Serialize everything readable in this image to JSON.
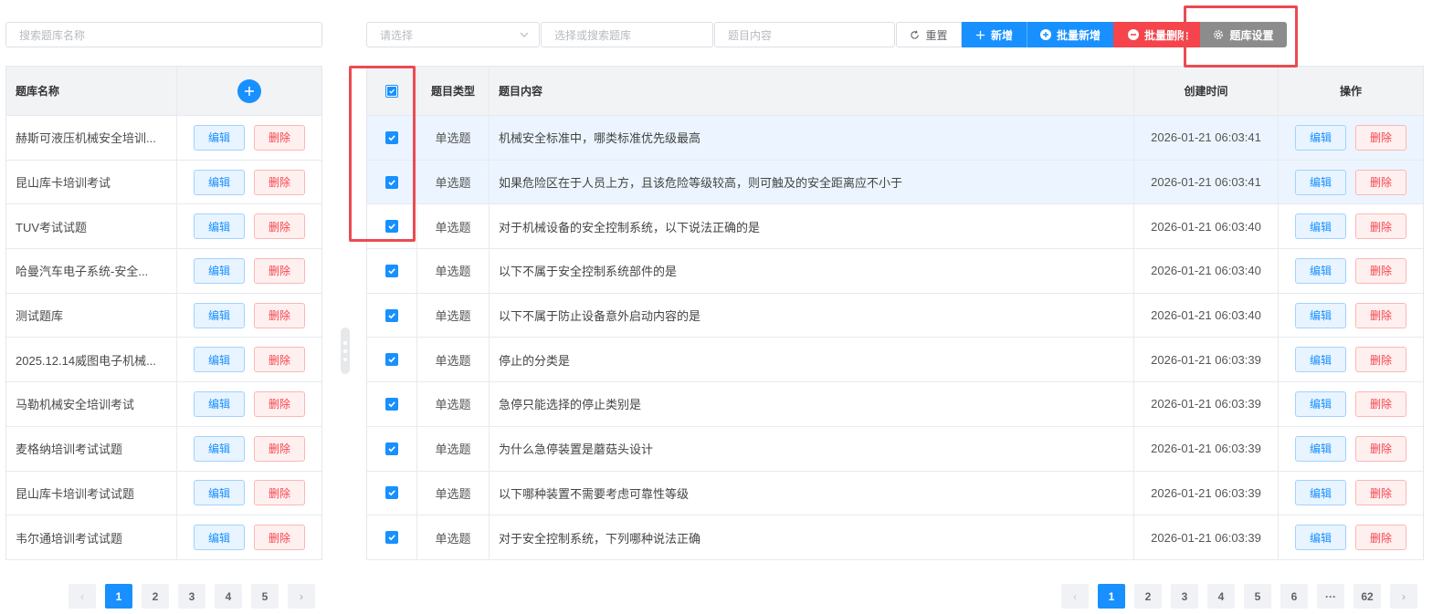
{
  "search_library_placeholder": "搜索题库名称",
  "filters": {
    "select_placeholder": "请选择",
    "library_placeholder": "选择或搜索题库",
    "content_placeholder": "题目内容"
  },
  "toolbar": {
    "reset": "重置",
    "add": "新增",
    "batch_add": "批量新增",
    "batch_delete": "批量删除",
    "library_settings": "题库设置"
  },
  "left_table": {
    "header_name": "题库名称",
    "edit_label": "编辑",
    "delete_label": "删除",
    "rows": [
      "赫斯可液压机械安全培训...",
      "昆山库卡培训考试",
      "TUV考试试题",
      "哈曼汽车电子系统-安全...",
      "测试题库",
      "2025.12.14威图电子机械...",
      "马勒机械安全培训考试",
      "麦格纳培训考试试题",
      "昆山库卡培训考试试题",
      "韦尔通培训考试试题"
    ]
  },
  "right_table": {
    "headers": {
      "type": "题目类型",
      "content": "题目内容",
      "time": "创建时间",
      "ops": "操作"
    },
    "edit_label": "编辑",
    "delete_label": "删除",
    "rows": [
      {
        "type": "单选题",
        "content": "机械安全标准中，哪类标准优先级最高",
        "time": "2026-01-21 06:03:41",
        "checked": true
      },
      {
        "type": "单选题",
        "content": "如果危险区在于人员上方，且该危险等级较高，则可触及的安全距离应不小于",
        "time": "2026-01-21 06:03:41",
        "checked": true
      },
      {
        "type": "单选题",
        "content": "对于机械设备的安全控制系统，以下说法正确的是",
        "time": "2026-01-21 06:03:40",
        "checked": true
      },
      {
        "type": "单选题",
        "content": "以下不属于安全控制系统部件的是",
        "time": "2026-01-21 06:03:40",
        "checked": true
      },
      {
        "type": "单选题",
        "content": "以下不属于防止设备意外启动内容的是",
        "time": "2026-01-21 06:03:40",
        "checked": true
      },
      {
        "type": "单选题",
        "content": "停止的分类是",
        "time": "2026-01-21 06:03:39",
        "checked": true
      },
      {
        "type": "单选题",
        "content": "急停只能选择的停止类别是",
        "time": "2026-01-21 06:03:39",
        "checked": true
      },
      {
        "type": "单选题",
        "content": "为什么急停装置是蘑菇头设计",
        "time": "2026-01-21 06:03:39",
        "checked": true
      },
      {
        "type": "单选题",
        "content": "以下哪种装置不需要考虑可靠性等级",
        "time": "2026-01-21 06:03:39",
        "checked": true
      },
      {
        "type": "单选题",
        "content": "对于安全控制系统，下列哪种说法正确",
        "time": "2026-01-21 06:03:39",
        "checked": true
      }
    ]
  },
  "left_pagination": {
    "prev": "‹",
    "pages": [
      "1",
      "2",
      "3",
      "4",
      "5"
    ],
    "current": "1",
    "next": "›"
  },
  "right_pagination": {
    "prev": "‹",
    "pages": [
      "1",
      "2",
      "3",
      "4",
      "5",
      "6",
      "···",
      "62"
    ],
    "current": "1",
    "next": "›"
  },
  "colors": {
    "primary": "#1890ff",
    "danger": "#f5444c",
    "neutral": "#8c8c8c",
    "annotation": "#ea4b52"
  },
  "icons": [
    "chevron-down-icon",
    "refresh-icon",
    "plus-icon",
    "plus-circle-icon",
    "minus-circle-icon",
    "gear-icon",
    "check-icon",
    "drag-handle-icon"
  ]
}
